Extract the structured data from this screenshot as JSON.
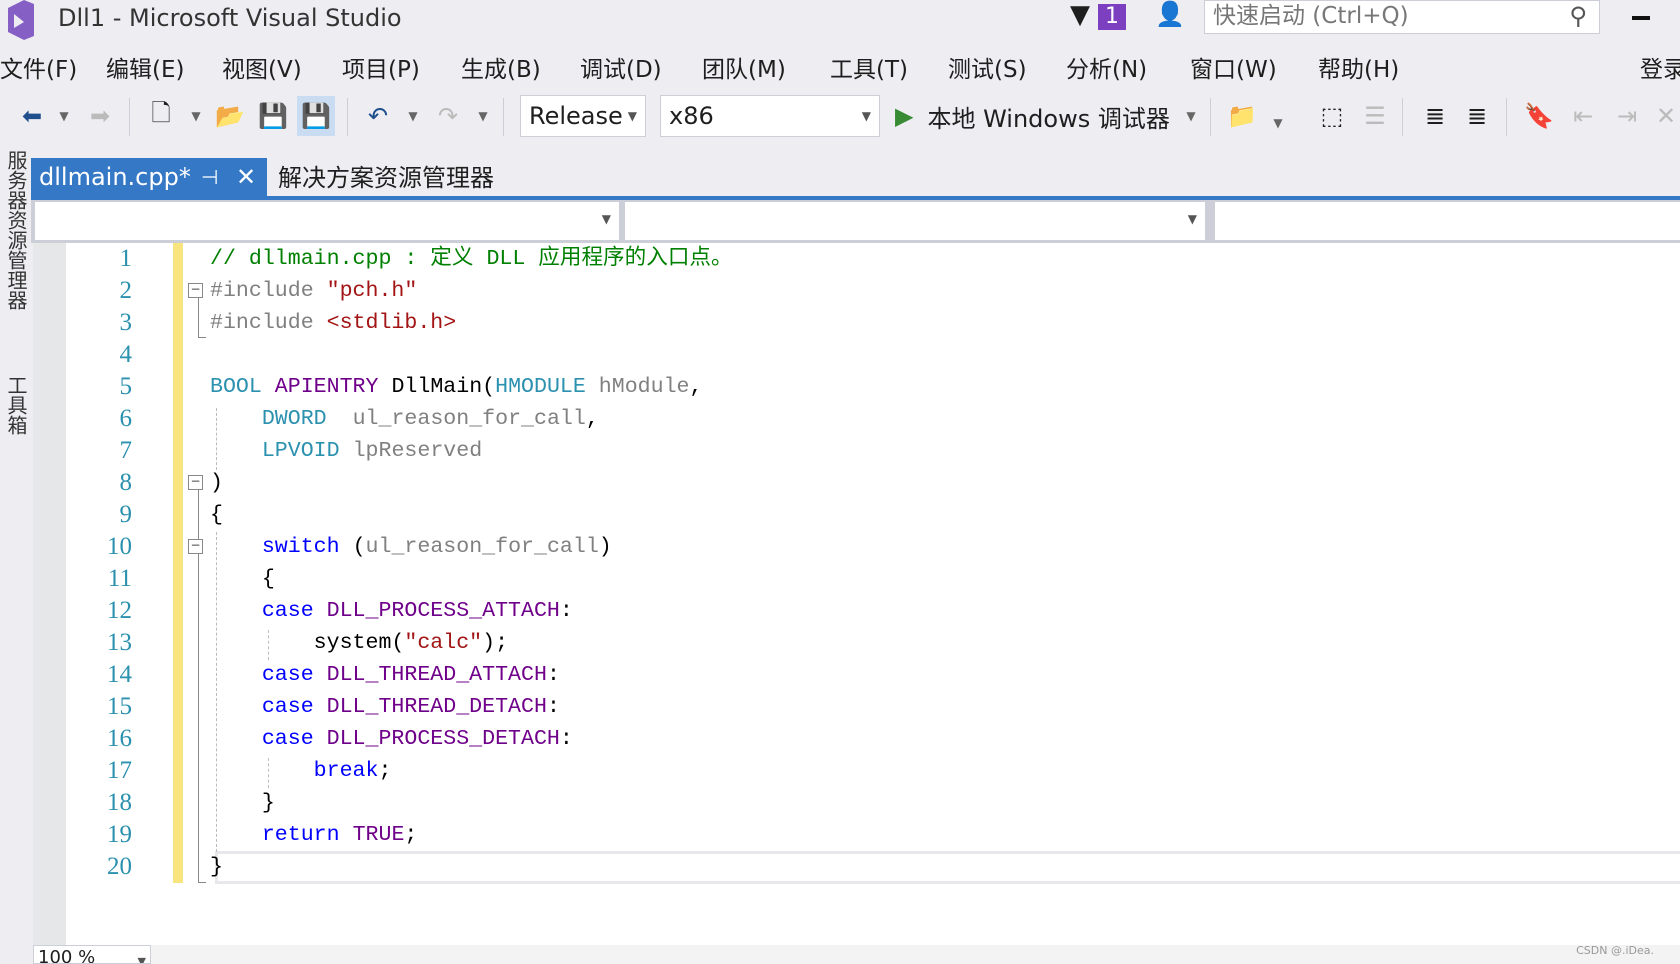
{
  "window": {
    "title": "Dll1 - Microsoft Visual Studio",
    "notification_count": "1",
    "search_placeholder": "快速启动 (Ctrl+Q)",
    "minimize": "–",
    "signin": "登录"
  },
  "menu": [
    "文件(F)",
    "编辑(E)",
    "视图(V)",
    "项目(P)",
    "生成(B)",
    "调试(D)",
    "团队(M)",
    "工具(T)",
    "测试(S)",
    "分析(N)",
    "窗口(W)",
    "帮助(H)"
  ],
  "toolbar": {
    "configuration": "Release",
    "platform": "x86",
    "debugger_label": "本地 Windows 调试器",
    "accent": "#3478c6"
  },
  "tabs": {
    "active": "dllmain.cpp*",
    "pin": "⊣",
    "close": "✕",
    "other": "解决方案资源管理器"
  },
  "side_panels": [
    "服务器资源管理器",
    "工具箱"
  ],
  "editor": {
    "lines": [
      [
        [
          "cm",
          "// dllmain.cpp : 定义 DLL 应用程序的入口点。"
        ]
      ],
      [
        [
          "pp",
          "#include "
        ],
        [
          "st",
          "\"pch.h\""
        ]
      ],
      [
        [
          "pp",
          "#include "
        ],
        [
          "st",
          "<stdlib.h>"
        ]
      ],
      [],
      [
        [
          "ty",
          "BOOL "
        ],
        [
          "mac",
          "APIENTRY "
        ],
        [
          "",
          "DllMain("
        ],
        [
          "ty",
          "HMODULE "
        ],
        [
          "pa",
          "hModule"
        ],
        [
          "",
          ","
        ]
      ],
      [
        [
          "",
          "    "
        ],
        [
          "ty",
          "DWORD  "
        ],
        [
          "pa",
          "ul_reason_for_call"
        ],
        [
          "",
          ","
        ]
      ],
      [
        [
          "",
          "    "
        ],
        [
          "ty",
          "LPVOID "
        ],
        [
          "pa",
          "lpReserved"
        ]
      ],
      [
        [
          "",
          ")"
        ]
      ],
      [
        [
          "",
          "{"
        ]
      ],
      [
        [
          "",
          "    "
        ],
        [
          "k",
          "switch "
        ],
        [
          "",
          "("
        ],
        [
          "pa",
          "ul_reason_for_call"
        ],
        [
          "",
          ")"
        ]
      ],
      [
        [
          "",
          "    {"
        ]
      ],
      [
        [
          "",
          "    "
        ],
        [
          "k",
          "case "
        ],
        [
          "mac",
          "DLL_PROCESS_ATTACH"
        ],
        [
          "",
          ":"
        ]
      ],
      [
        [
          "",
          "        system("
        ],
        [
          "st",
          "\"calc\""
        ],
        [
          "",
          ");"
        ]
      ],
      [
        [
          "",
          "    "
        ],
        [
          "k",
          "case "
        ],
        [
          "mac",
          "DLL_THREAD_ATTACH"
        ],
        [
          "",
          ":"
        ]
      ],
      [
        [
          "",
          "    "
        ],
        [
          "k",
          "case "
        ],
        [
          "mac",
          "DLL_THREAD_DETACH"
        ],
        [
          "",
          ":"
        ]
      ],
      [
        [
          "",
          "    "
        ],
        [
          "k",
          "case "
        ],
        [
          "mac",
          "DLL_PROCESS_DETACH"
        ],
        [
          "",
          ":"
        ]
      ],
      [
        [
          "",
          "        "
        ],
        [
          "k",
          "break"
        ],
        [
          "",
          ";"
        ]
      ],
      [
        [
          "",
          "    }"
        ]
      ],
      [
        [
          "",
          "    "
        ],
        [
          "k",
          "return "
        ],
        [
          "mac",
          "TRUE"
        ],
        [
          "",
          ";"
        ]
      ],
      [
        [
          "",
          "}"
        ]
      ]
    ],
    "fold_lines": [
      2,
      8,
      10
    ],
    "current_line": 20,
    "zoom": "100 %"
  },
  "watermark": "CSDN @.iDea."
}
